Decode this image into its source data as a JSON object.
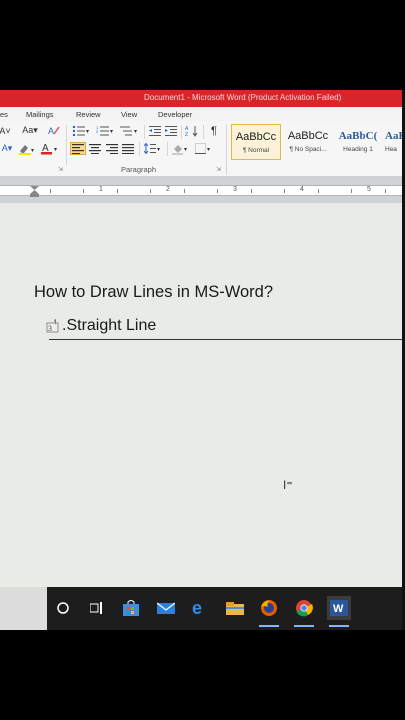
{
  "window": {
    "title": "Document1 - Microsoft Word (Product Activation Failed)"
  },
  "tabs": [
    "Mailings",
    "Review",
    "View",
    "Developer"
  ],
  "ribbon": {
    "paragraph_group_label": "Paragraph",
    "styles": [
      {
        "sample": "AaBbCc",
        "name": "¶ Normal",
        "selected": true
      },
      {
        "sample": "AaBbCc",
        "name": "¶ No Spaci...",
        "selected": false
      },
      {
        "sample": "AaBbC(",
        "name": "Heading 1",
        "selected": false
      },
      {
        "sample": "AaB",
        "name": "Hea",
        "selected": false
      }
    ]
  },
  "ruler": {
    "numbers": [
      "1",
      "2",
      "3",
      "4",
      "5"
    ]
  },
  "document": {
    "title": "How to Draw Lines in MS-Word?",
    "item_text": ".Straight Line"
  },
  "taskbar": {
    "items": [
      "cortana-circle",
      "task-view",
      "store",
      "mail",
      "edge",
      "file-explorer",
      "firefox",
      "chrome",
      "word"
    ]
  },
  "colors": {
    "titlebar": "#d7262a",
    "taskbar": "#1d1d1d",
    "accent": "#8ab4ff"
  }
}
